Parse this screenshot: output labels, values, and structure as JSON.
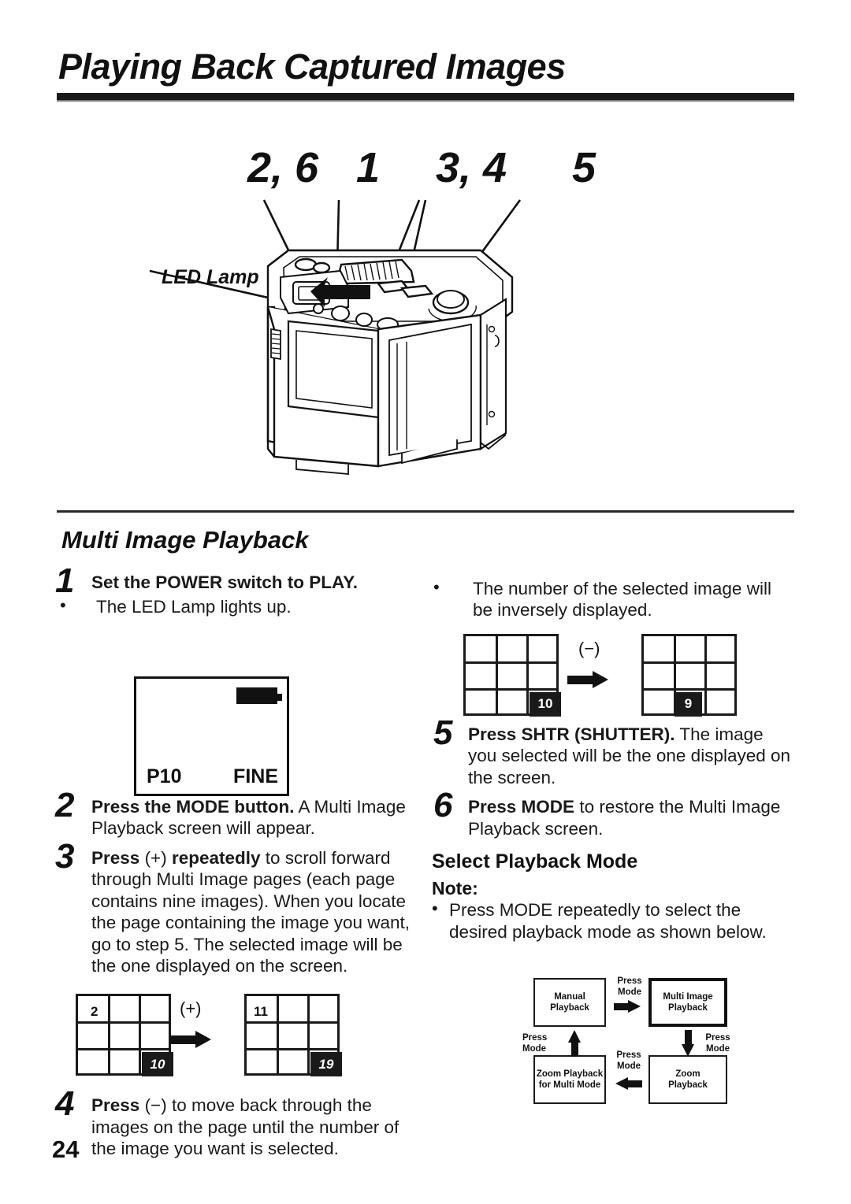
{
  "document": {
    "title": "Playing Back Captured Images",
    "page_number": "24"
  },
  "figure": {
    "callouts": [
      "2, 6",
      "1",
      "3, 4",
      "5"
    ],
    "led_label": "LED Lamp"
  },
  "section": {
    "heading": "Multi Image Playback",
    "subheading": "Select Playback Mode"
  },
  "lcd_screen": {
    "page_indicator": "P10",
    "quality_indicator": "FINE",
    "battery_icon": "battery-full-icon"
  },
  "steps_left": [
    {
      "number": "1",
      "bold": "Set the POWER switch to PLAY.",
      "rest": ""
    },
    {
      "number": "2",
      "bold": "Press the MODE button.",
      "rest": " A Multi Image Playback screen will appear."
    },
    {
      "number": "3",
      "bold_a": "Press",
      "sign": " (+) ",
      "bold_b": "repeatedly",
      "rest": " to scroll forward through Multi Image pages (each page contains nine images). When you locate the page containing the image you want, go to step 5. The selected image will be the one displayed on the screen."
    },
    {
      "number": "4",
      "bold": "Press",
      "sign": " (−) ",
      "rest": "to move back through the images on the page until the number of the image you want is selected."
    }
  ],
  "steps_right": [
    {
      "number": "5",
      "bold": "Press SHTR (SHUTTER).",
      "rest": " The image you selected will be the one displayed on the screen."
    },
    {
      "number": "6",
      "bold": "Press MODE",
      "rest": " to restore the Multi Image Playback screen."
    }
  ],
  "bullets": {
    "led_lights": "The LED Lamp lights up.",
    "inverse": "The number of the selected image will be inversely displayed.",
    "note_label": "Note:",
    "note_text": "Press MODE repeatedly to select the desired playback mode as shown below."
  },
  "grids_left": {
    "operator": "(+)",
    "before": {
      "cell_number": "2",
      "badge": "10"
    },
    "after": {
      "cell_number": "11",
      "badge": "19"
    }
  },
  "grids_right": {
    "operator": "(−)",
    "before": {
      "badge": "10"
    },
    "after": {
      "badge": "9"
    }
  },
  "mode_flow": {
    "boxes": [
      {
        "id": "manual",
        "label": "Manual\nPlayback"
      },
      {
        "id": "multi",
        "label": "Multi Image\nPlayback",
        "highlighted": true
      },
      {
        "id": "zoom",
        "label": "Zoom\nPlayback"
      },
      {
        "id": "zoom_multi",
        "label": "Zoom Playback\nfor Multi Mode"
      }
    ],
    "transition_label": "Press\nMode",
    "box_manual_l1": "Manual",
    "box_manual_l2": "Playback",
    "box_multi_l1": "Multi Image",
    "box_multi_l2": "Playback",
    "box_zoom_l1": "Zoom",
    "box_zoom_l2": "Playback",
    "box_zoommulti_l1": "Zoom Playback",
    "box_zoommulti_l2": "for Multi Mode",
    "press_l1": "Press",
    "press_l2": "Mode"
  }
}
